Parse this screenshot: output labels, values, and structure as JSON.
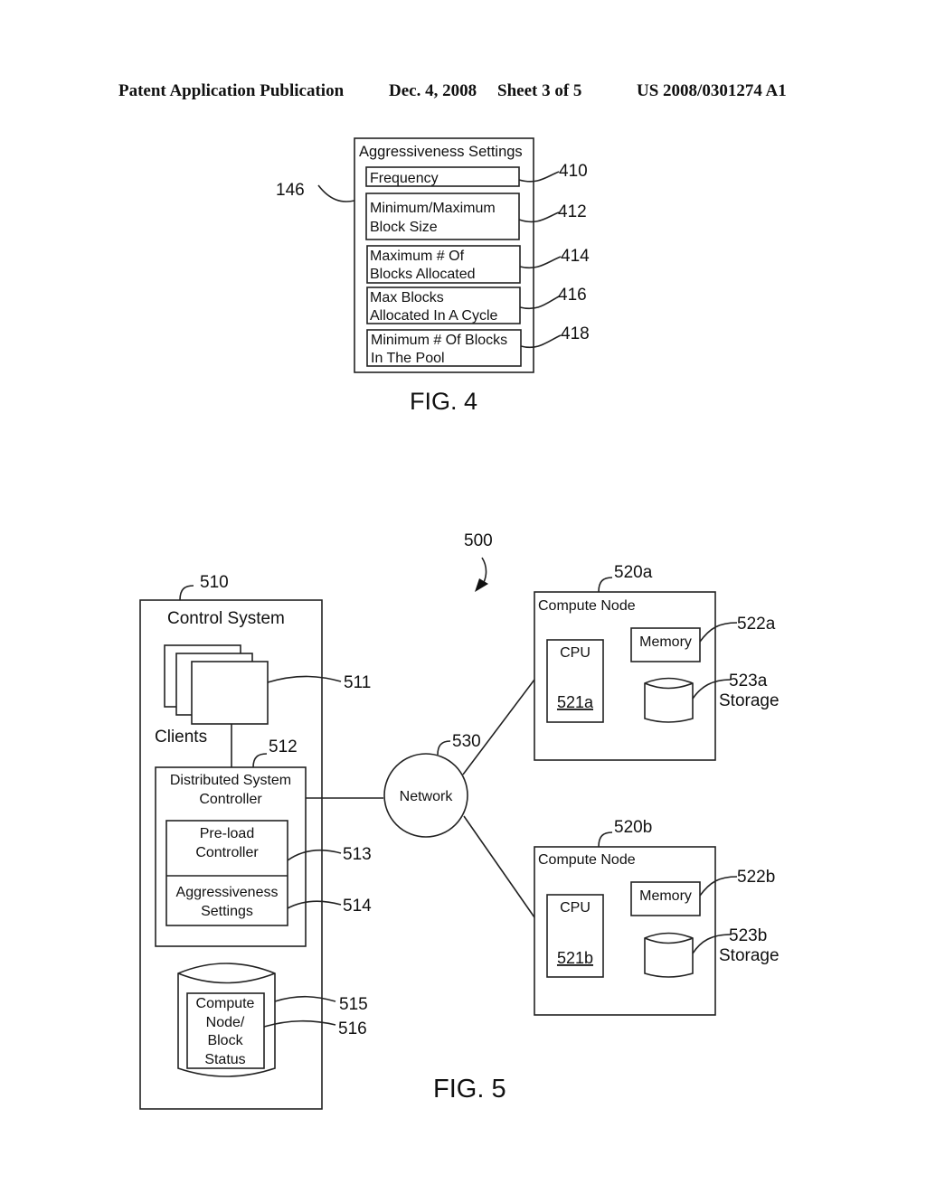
{
  "header": {
    "left": "Patent Application Publication",
    "date": "Dec. 4, 2008",
    "sheet": "Sheet 3 of 5",
    "number": "US 2008/0301274 A1"
  },
  "fig4": {
    "caption": "FIG. 4",
    "ref_container": "146",
    "title": "Aggressiveness Settings",
    "items": [
      {
        "lines": [
          "Frequency"
        ],
        "ref": "410"
      },
      {
        "lines": [
          "Minimum/Maximum",
          "Block Size"
        ],
        "ref": "412"
      },
      {
        "lines": [
          "Maximum # Of",
          "Blocks Allocated"
        ],
        "ref": "414"
      },
      {
        "lines": [
          "Max Blocks",
          "Allocated In A Cycle"
        ],
        "ref": "416"
      },
      {
        "lines": [
          "Minimum # Of Blocks",
          "In The Pool"
        ],
        "ref": "418"
      }
    ]
  },
  "fig5": {
    "caption": "FIG. 5",
    "ref_system": "500",
    "control_system": {
      "ref": "510",
      "title": "Control System",
      "clients_label": "Clients",
      "clients_ref": "511",
      "dsc_ref": "512",
      "dsc_lines": [
        "Distributed System",
        "Controller"
      ],
      "preload_lines": [
        "Pre-load",
        "Controller"
      ],
      "preload_ref": "513",
      "aggr_lines": [
        "Aggressiveness",
        "Settings"
      ],
      "aggr_ref": "514",
      "db_ref": "515",
      "status_lines": [
        "Compute",
        "Node/",
        "Block",
        "Status"
      ],
      "status_ref": "516"
    },
    "network": {
      "label": "Network",
      "ref": "530"
    },
    "nodes": [
      {
        "ref": "520a",
        "title": "Compute Node",
        "cpu": "CPU",
        "cpu_ref": "521a",
        "memory": "Memory",
        "memory_ref": "522a",
        "storage_ref": "523a",
        "storage": "Storage"
      },
      {
        "ref": "520b",
        "title": "Compute Node",
        "cpu": "CPU",
        "cpu_ref": "521b",
        "memory": "Memory",
        "memory_ref": "522b",
        "storage_ref": "523b",
        "storage": "Storage"
      }
    ]
  }
}
